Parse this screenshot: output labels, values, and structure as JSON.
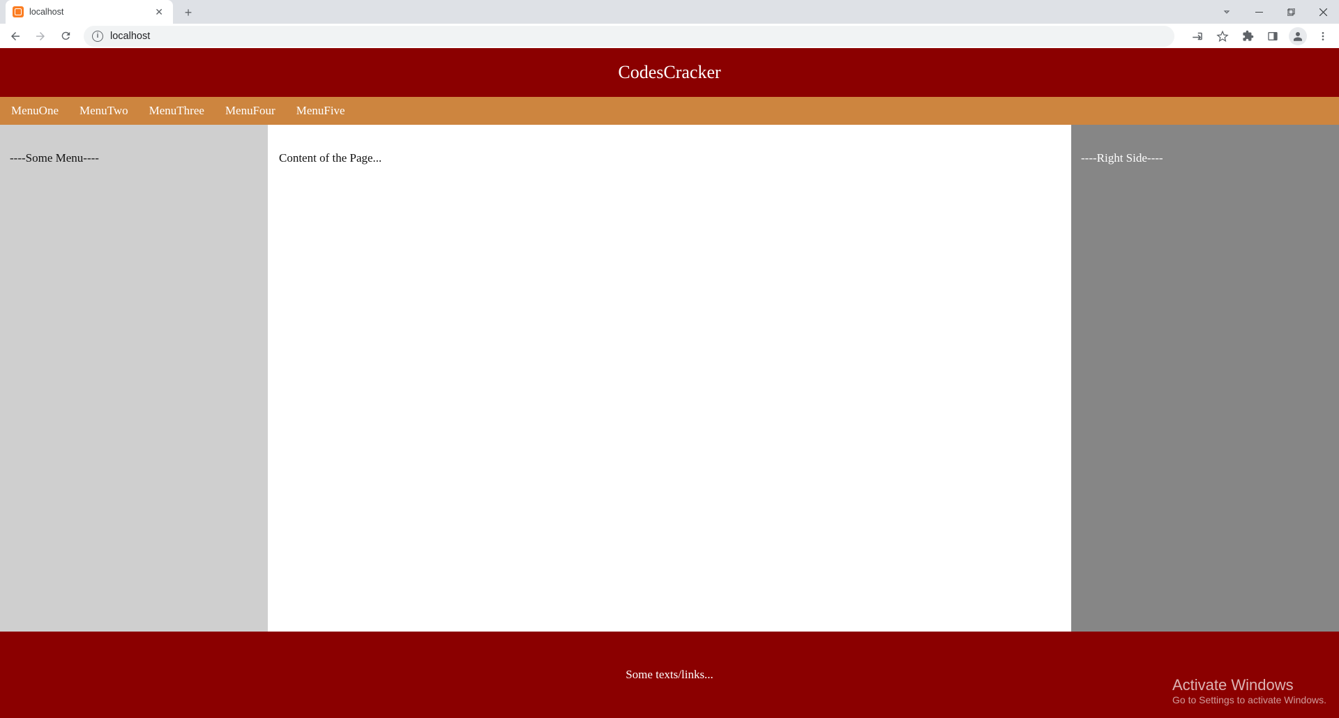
{
  "browser": {
    "tab_title": "localhost",
    "url": "localhost"
  },
  "page": {
    "header_title": "CodesCracker",
    "menu": [
      "MenuOne",
      "MenuTwo",
      "MenuThree",
      "MenuFour",
      "MenuFive"
    ],
    "left_sidebar": "----Some Menu----",
    "main_content": "Content of the Page...",
    "right_sidebar": "----Right Side----",
    "footer": "Some texts/links..."
  },
  "watermark": {
    "title": "Activate Windows",
    "subtitle": "Go to Settings to activate Windows."
  }
}
